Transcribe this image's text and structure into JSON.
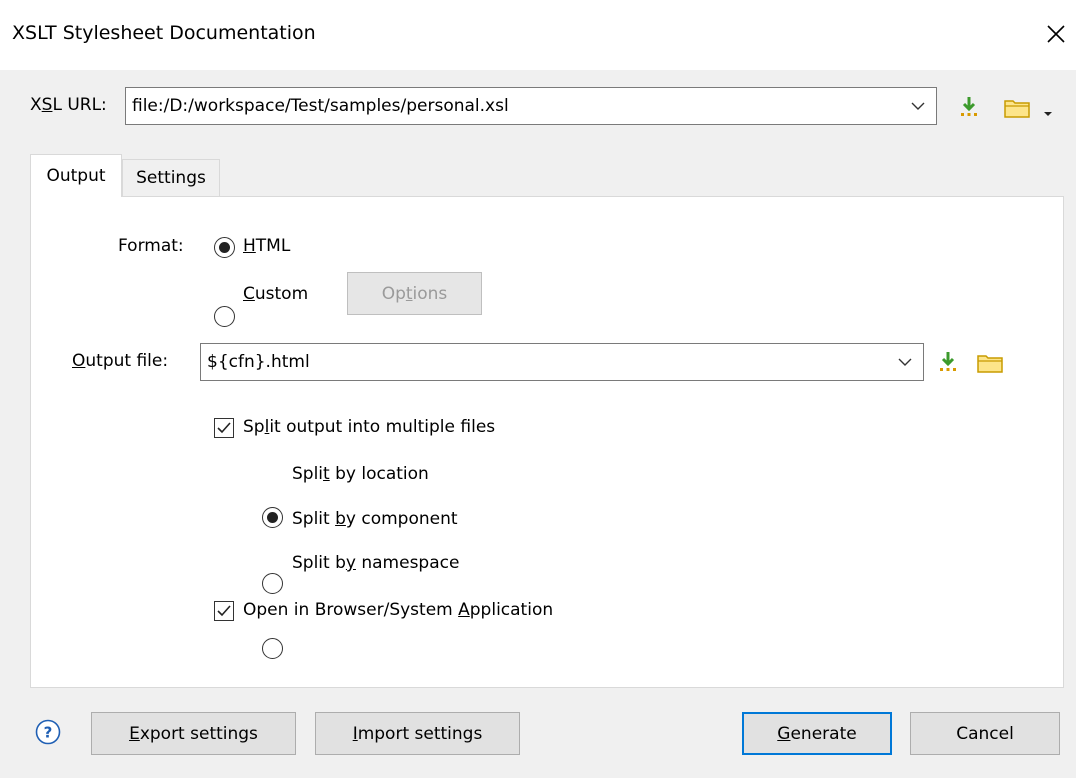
{
  "dialog": {
    "title": "XSLT Stylesheet Documentation"
  },
  "xsl_url": {
    "label_pre": "X",
    "label_u": "S",
    "label_post": "L URL:",
    "value": "file:/D:/workspace/Test/samples/personal.xsl"
  },
  "tabs": [
    {
      "label": "Output",
      "active": true
    },
    {
      "label": "Settings",
      "active": false
    }
  ],
  "format": {
    "label": "Format:",
    "html": {
      "u": "H",
      "rest": "TML",
      "selected": true
    },
    "custom": {
      "u": "C",
      "rest": "ustom",
      "selected": false
    },
    "options_button": {
      "pre": "Op",
      "u": "t",
      "post": "ions",
      "enabled": false
    }
  },
  "output_file": {
    "label_u": "O",
    "label_rest": "utput file:",
    "value": "${cfn}.html"
  },
  "split": {
    "checkbox": {
      "pre": "Sp",
      "u": "l",
      "post": "it output into multiple files",
      "checked": true
    },
    "by_location": {
      "pre": "Spli",
      "u": "t",
      "post": " by location",
      "selected": true
    },
    "by_component": {
      "pre": "Split ",
      "u": "b",
      "post": "y component",
      "selected": false
    },
    "by_namespace": {
      "pre": "Split b",
      "u": "y",
      "post": " namespace",
      "selected": false
    }
  },
  "open_in_browser": {
    "pre": "Open in Browser/System ",
    "u": "A",
    "post": "pplication",
    "checked": true
  },
  "footer": {
    "help_icon": "?",
    "export": {
      "u": "E",
      "rest": "xport settings"
    },
    "import": {
      "u": "I",
      "rest": "mport settings"
    },
    "generate": {
      "u": "G",
      "rest": "enerate"
    },
    "cancel": "Cancel"
  },
  "colors": {
    "accent": "#0078d7",
    "folder": "#e8b800",
    "download": "#3c9a2c"
  }
}
